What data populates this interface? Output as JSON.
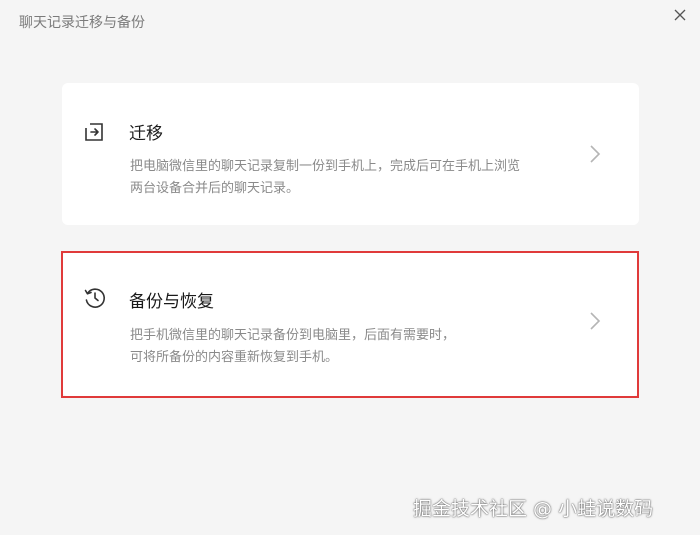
{
  "window": {
    "title": "聊天记录迁移与备份",
    "close_icon": "close-icon"
  },
  "options": [
    {
      "title": "迁移",
      "description": "把电脑微信里的聊天记录复制一份到手机上，完成后可在手机上浏览两台设备合并后的聊天记录。",
      "icon": "migrate-icon"
    },
    {
      "title": "备份与恢复",
      "description_line1": "把手机微信里的聊天记录备份到电脑里，后面有需要时，",
      "description_line2": "可将所备份的内容重新恢复到手机。",
      "icon": "history-clock-icon"
    }
  ],
  "highlight_color": "#e03a3a",
  "watermark": "掘金技术社区 @ 小蛙说数码"
}
